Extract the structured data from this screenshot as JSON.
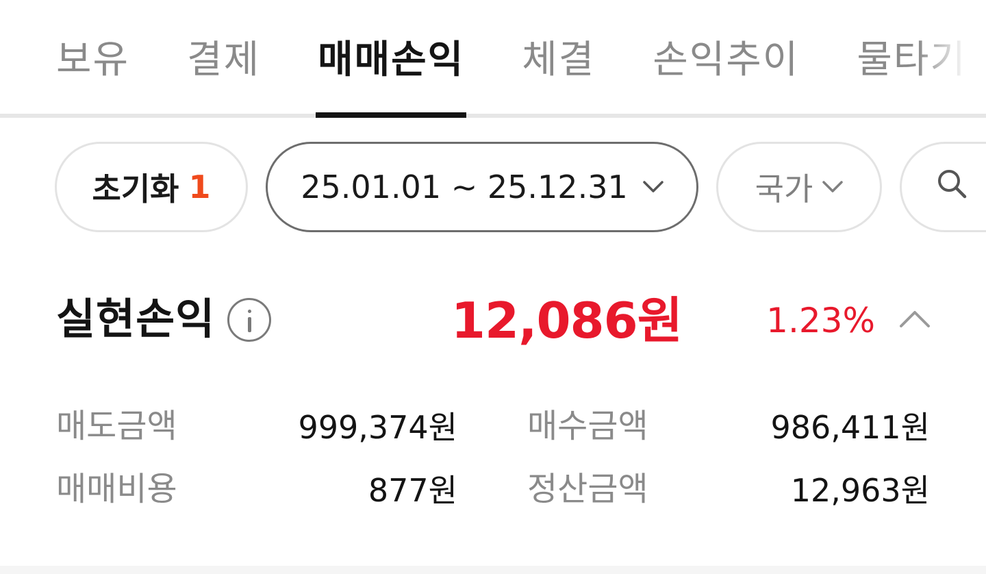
{
  "tabs": [
    {
      "label": "보유"
    },
    {
      "label": "결제"
    },
    {
      "label": "매매손익"
    },
    {
      "label": "체결"
    },
    {
      "label": "손익추이"
    },
    {
      "label": "물타기"
    }
  ],
  "active_tab": "매매손익",
  "filters": {
    "reset_label": "초기화",
    "reset_count": "1",
    "period": "25.01.01 ~ 25.12.31",
    "country": "국가"
  },
  "summary": {
    "title": "실현손익",
    "amount": "12,086원",
    "rate": "1.23%",
    "accent_color": "#e8192c"
  },
  "details": {
    "sell_amount_label": "매도금액",
    "sell_amount_value": "999,374원",
    "buy_amount_label": "매수금액",
    "buy_amount_value": "986,411원",
    "fee_label": "매매비용",
    "fee_value": "877원",
    "settlement_label": "정산금액",
    "settlement_value": "12,963원"
  },
  "icons": {
    "info": "info-icon",
    "period_chevron": "chevron-down-icon",
    "country_chevron": "chevron-down-icon",
    "search": "search-icon",
    "collapse": "chevron-up-icon"
  }
}
